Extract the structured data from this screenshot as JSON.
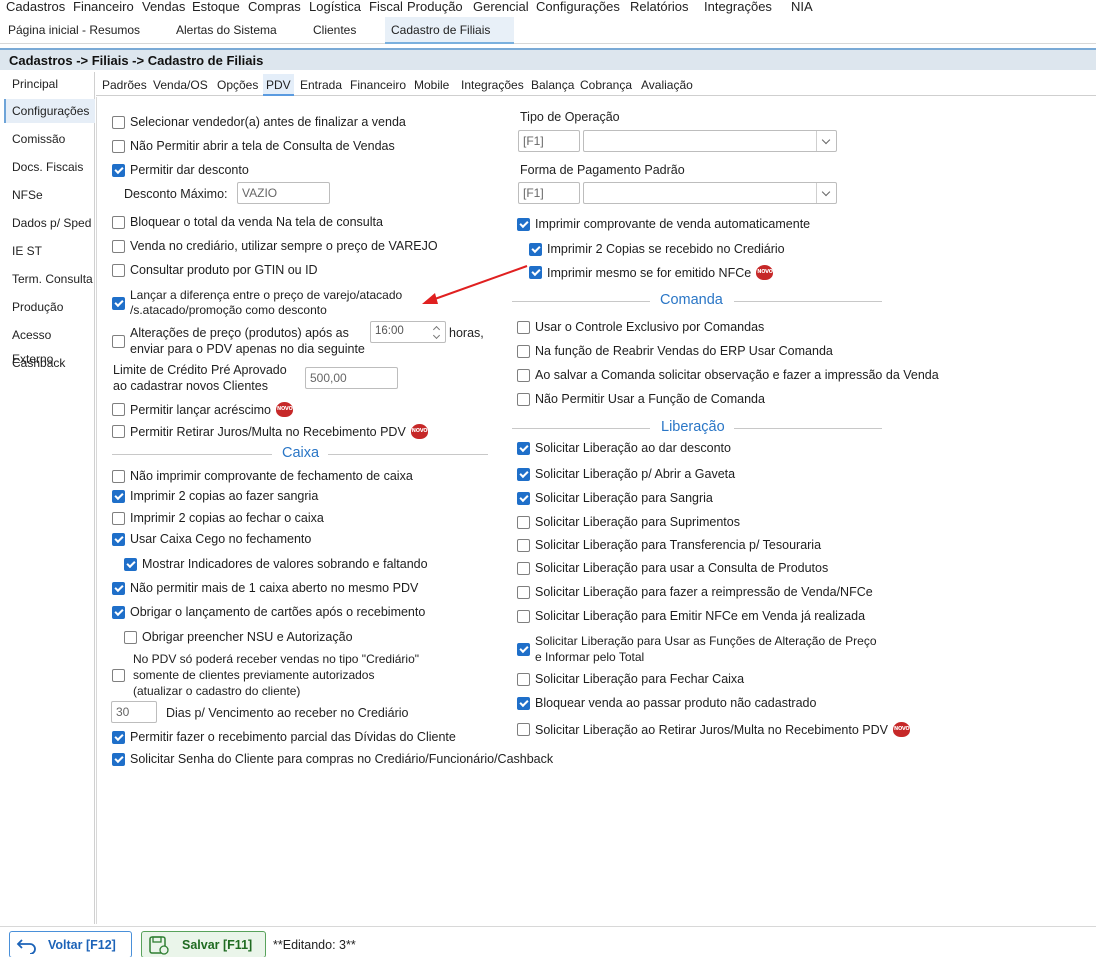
{
  "menu": [
    "Cadastros",
    "Financeiro",
    "Vendas",
    "Estoque",
    "Compras",
    "Logística",
    "Fiscal",
    "Produção",
    "Gerencial",
    "Configurações",
    "Relatórios",
    "Integrações",
    "NIA"
  ],
  "tabs": [
    "Página inicial - Resumos",
    "Alertas do Sistema",
    "Clientes",
    "Cadastro de Filiais"
  ],
  "breadcrumb": "Cadastros -> Filiais -> Cadastro de Filiais",
  "leftnav": [
    "Principal",
    "Configurações",
    "Comissão",
    "Docs. Fiscais",
    "NFSe",
    "Dados p/ Sped",
    "IE ST",
    "Term. Consulta",
    "Produção",
    "Acesso Externo",
    "Cashback"
  ],
  "subtabs": [
    "Padrões",
    "Venda/OS",
    "Opções",
    "PDV",
    "Entrada",
    "Financeiro",
    "Mobile",
    "Integrações",
    "Balança",
    "Cobrança",
    "Avaliação"
  ],
  "badge_text": "NOVO",
  "left": {
    "selecionar_vendedor": "Selecionar vendedor(a) antes de finalizar a venda",
    "nao_permitir_consulta": "Não Permitir abrir a tela de Consulta de Vendas",
    "permitir_desconto": "Permitir dar desconto",
    "desconto_maximo_label": "Desconto Máximo:",
    "desconto_maximo_value": "VAZIO",
    "bloquear_total": "Bloquear o total da venda Na tela de consulta",
    "venda_crediario": "Venda no crediário, utilizar sempre o preço de VAREJO",
    "consultar_gtin": "Consultar produto por GTIN ou ID",
    "lancar_diferenca_1": "Lançar a diferença entre o preço de varejo/atacado",
    "lancar_diferenca_2": "/s.atacado/promoção como desconto",
    "alteracoes_preco_1": "Alterações de preço (produtos) após as",
    "alteracoes_preco_2": "enviar para o PDV apenas no dia seguinte",
    "hora_value": "16:00",
    "horas_label": "horas,",
    "limite_credito_1": "Limite de Crédito Pré Aprovado",
    "limite_credito_2": "ao cadastrar novos Clientes",
    "limite_value": "500,00",
    "permitir_acrescimo": "Permitir lançar acréscimo",
    "permitir_retirar_juros": "Permitir Retirar Juros/Multa no Recebimento PDV"
  },
  "caixa": {
    "title": "Caixa",
    "nao_imprimir": "Não imprimir comprovante de fechamento de caixa",
    "imprimir_sangria": "Imprimir 2 copias ao fazer sangria",
    "imprimir_fechar": "Imprimir 2 copias ao fechar o caixa",
    "caixa_cego": "Usar Caixa Cego no fechamento",
    "mostrar_indicadores": "Mostrar Indicadores de valores sobrando e faltando",
    "nao_permitir_mais": "Não permitir mais de 1 caixa aberto no mesmo PDV",
    "obrigar_cartoes": "Obrigar o lançamento de cartões após o recebimento",
    "obrigar_nsu": "Obrigar preencher NSU e Autorização",
    "crediario_1": "No PDV só poderá receber vendas no tipo \"Crediário\"",
    "crediario_2": "somente de clientes previamente autorizados",
    "crediario_3": "(atualizar o cadastro do cliente)",
    "dias_value": "30",
    "dias_label": "Dias p/ Vencimento ao receber no Crediário",
    "recebimento_parcial": "Permitir fazer o recebimento parcial das Dívidas do Cliente",
    "solicitar_senha": "Solicitar Senha do Cliente para compras no Crediário/Funcionário/Cashback"
  },
  "right": {
    "tipo_operacao": "Tipo de Operação",
    "tipo_operacao_code": "[F1]",
    "forma_pagamento": "Forma de Pagamento Padrão",
    "forma_pagamento_code": "[F1]",
    "imprimir_comprovante": "Imprimir comprovante de venda automaticamente",
    "imprimir_2_copias": "Imprimir 2 Copias se recebido no Crediário",
    "imprimir_nfce": "Imprimir mesmo se for emitido NFCe"
  },
  "comanda": {
    "title": "Comanda",
    "usar_controle": "Usar o Controle Exclusivo por Comandas",
    "reabrir_vendas": "Na função de Reabrir Vendas do ERP Usar Comanda",
    "salvar_comanda": "Ao salvar a Comanda solicitar observação e fazer a impressão da Venda",
    "nao_permitir": "Não Permitir Usar a Função de Comanda"
  },
  "liberacao": {
    "title": "Liberação",
    "desconto": "Solicitar Liberação ao dar desconto",
    "gaveta": "Solicitar Liberação p/ Abrir a Gaveta",
    "sangria": "Solicitar Liberação para Sangria",
    "suprimentos": "Solicitar Liberação para Suprimentos",
    "transferencia": "Solicitar Liberação para Transferencia p/ Tesouraria",
    "consulta_produtos": "Solicitar Liberação para usar a Consulta de Produtos",
    "reimpressao": "Solicitar Liberação para fazer a reimpressão de Venda/NFCe",
    "emitir_nfce": "Solicitar Liberação para Emitir NFCe em Venda já realizada",
    "alteracao_preco_1": "Solicitar Liberação para Usar as Funções de Alteração de Preço",
    "alteracao_preco_2": "e Informar pelo Total",
    "fechar_caixa": "Solicitar Liberação para Fechar Caixa",
    "bloquear_venda": "Bloquear venda ao passar produto não cadastrado",
    "retirar_juros": "Solicitar Liberação ao Retirar Juros/Multa no Recebimento PDV"
  },
  "buttons": {
    "back": "Voltar [F12]",
    "save": "Salvar [F11]"
  },
  "status": "**Editando: 3**",
  "accent_color": "#1f6fc9"
}
